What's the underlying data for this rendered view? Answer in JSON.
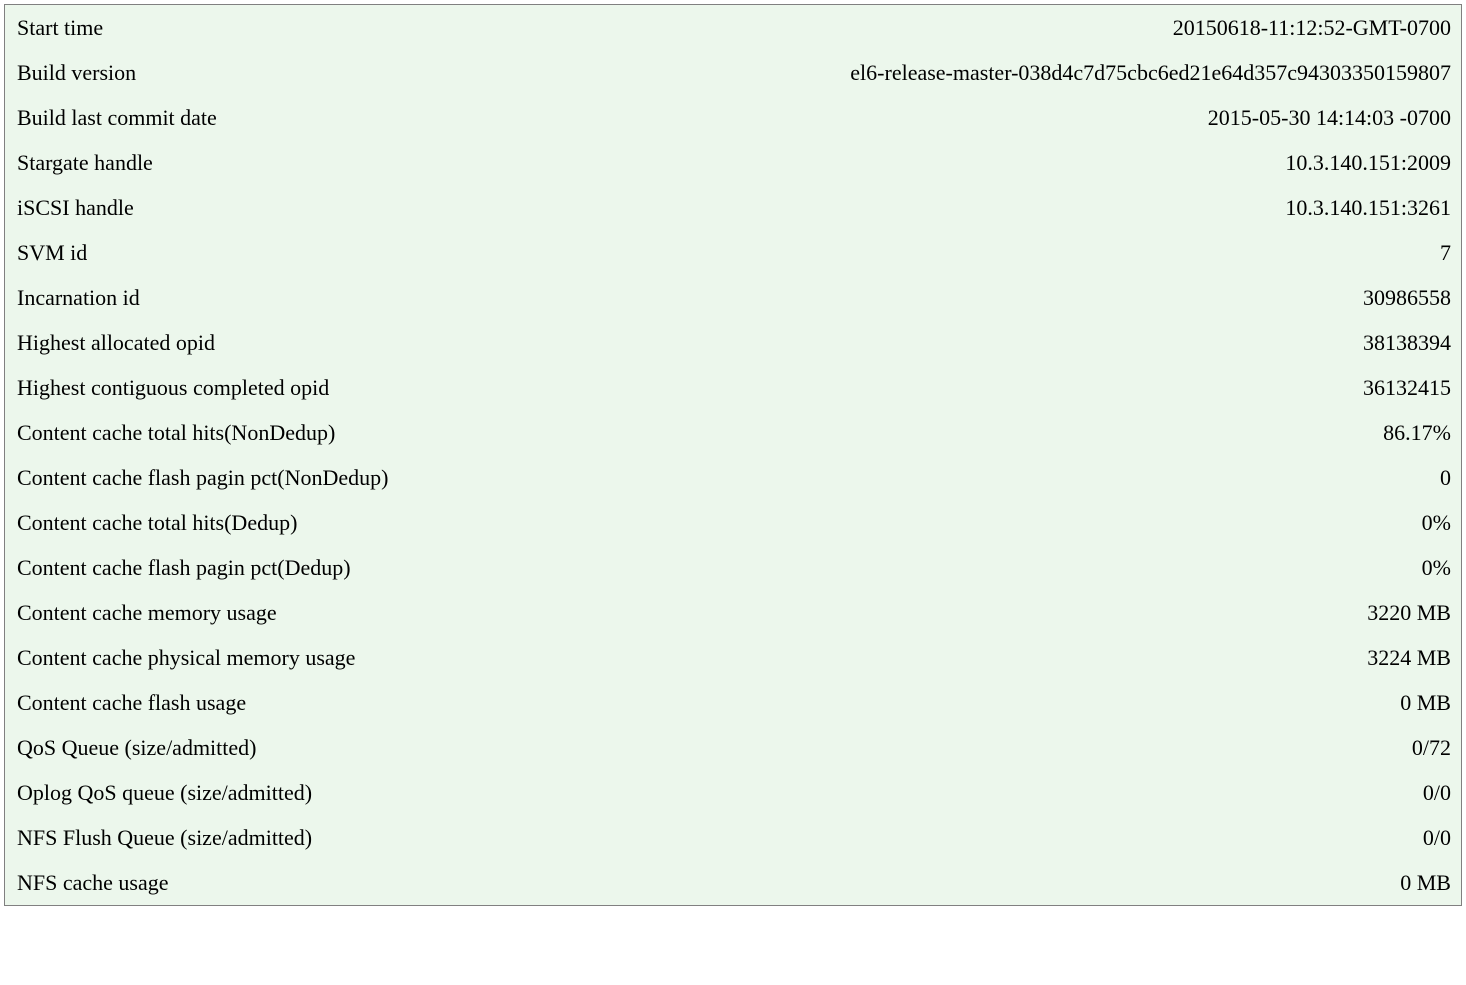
{
  "rows": [
    {
      "label": "Start time",
      "value": "20150618-11:12:52-GMT-0700"
    },
    {
      "label": "Build version",
      "value": "el6-release-master-038d4c7d75cbc6ed21e64d357c94303350159807"
    },
    {
      "label": "Build last commit date",
      "value": "2015-05-30 14:14:03 -0700"
    },
    {
      "label": "Stargate handle",
      "value": "10.3.140.151:2009"
    },
    {
      "label": "iSCSI handle",
      "value": "10.3.140.151:3261"
    },
    {
      "label": "SVM id",
      "value": "7"
    },
    {
      "label": "Incarnation id",
      "value": "30986558"
    },
    {
      "label": "Highest allocated opid",
      "value": "38138394"
    },
    {
      "label": "Highest contiguous completed opid",
      "value": "36132415"
    },
    {
      "label": "Content cache total hits(NonDedup)",
      "value": "86.17%"
    },
    {
      "label": "Content cache flash pagin pct(NonDedup)",
      "value": "0"
    },
    {
      "label": "Content cache total hits(Dedup)",
      "value": "0%"
    },
    {
      "label": "Content cache flash pagin pct(Dedup)",
      "value": "0%"
    },
    {
      "label": "Content cache memory usage",
      "value": "3220 MB"
    },
    {
      "label": "Content cache physical memory usage",
      "value": "3224 MB"
    },
    {
      "label": "Content cache flash usage",
      "value": "0 MB"
    },
    {
      "label": "QoS Queue (size/admitted)",
      "value": "0/72"
    },
    {
      "label": "Oplog QoS queue (size/admitted)",
      "value": "0/0"
    },
    {
      "label": "NFS Flush Queue (size/admitted)",
      "value": "0/0"
    },
    {
      "label": "NFS cache usage",
      "value": "0 MB"
    }
  ]
}
